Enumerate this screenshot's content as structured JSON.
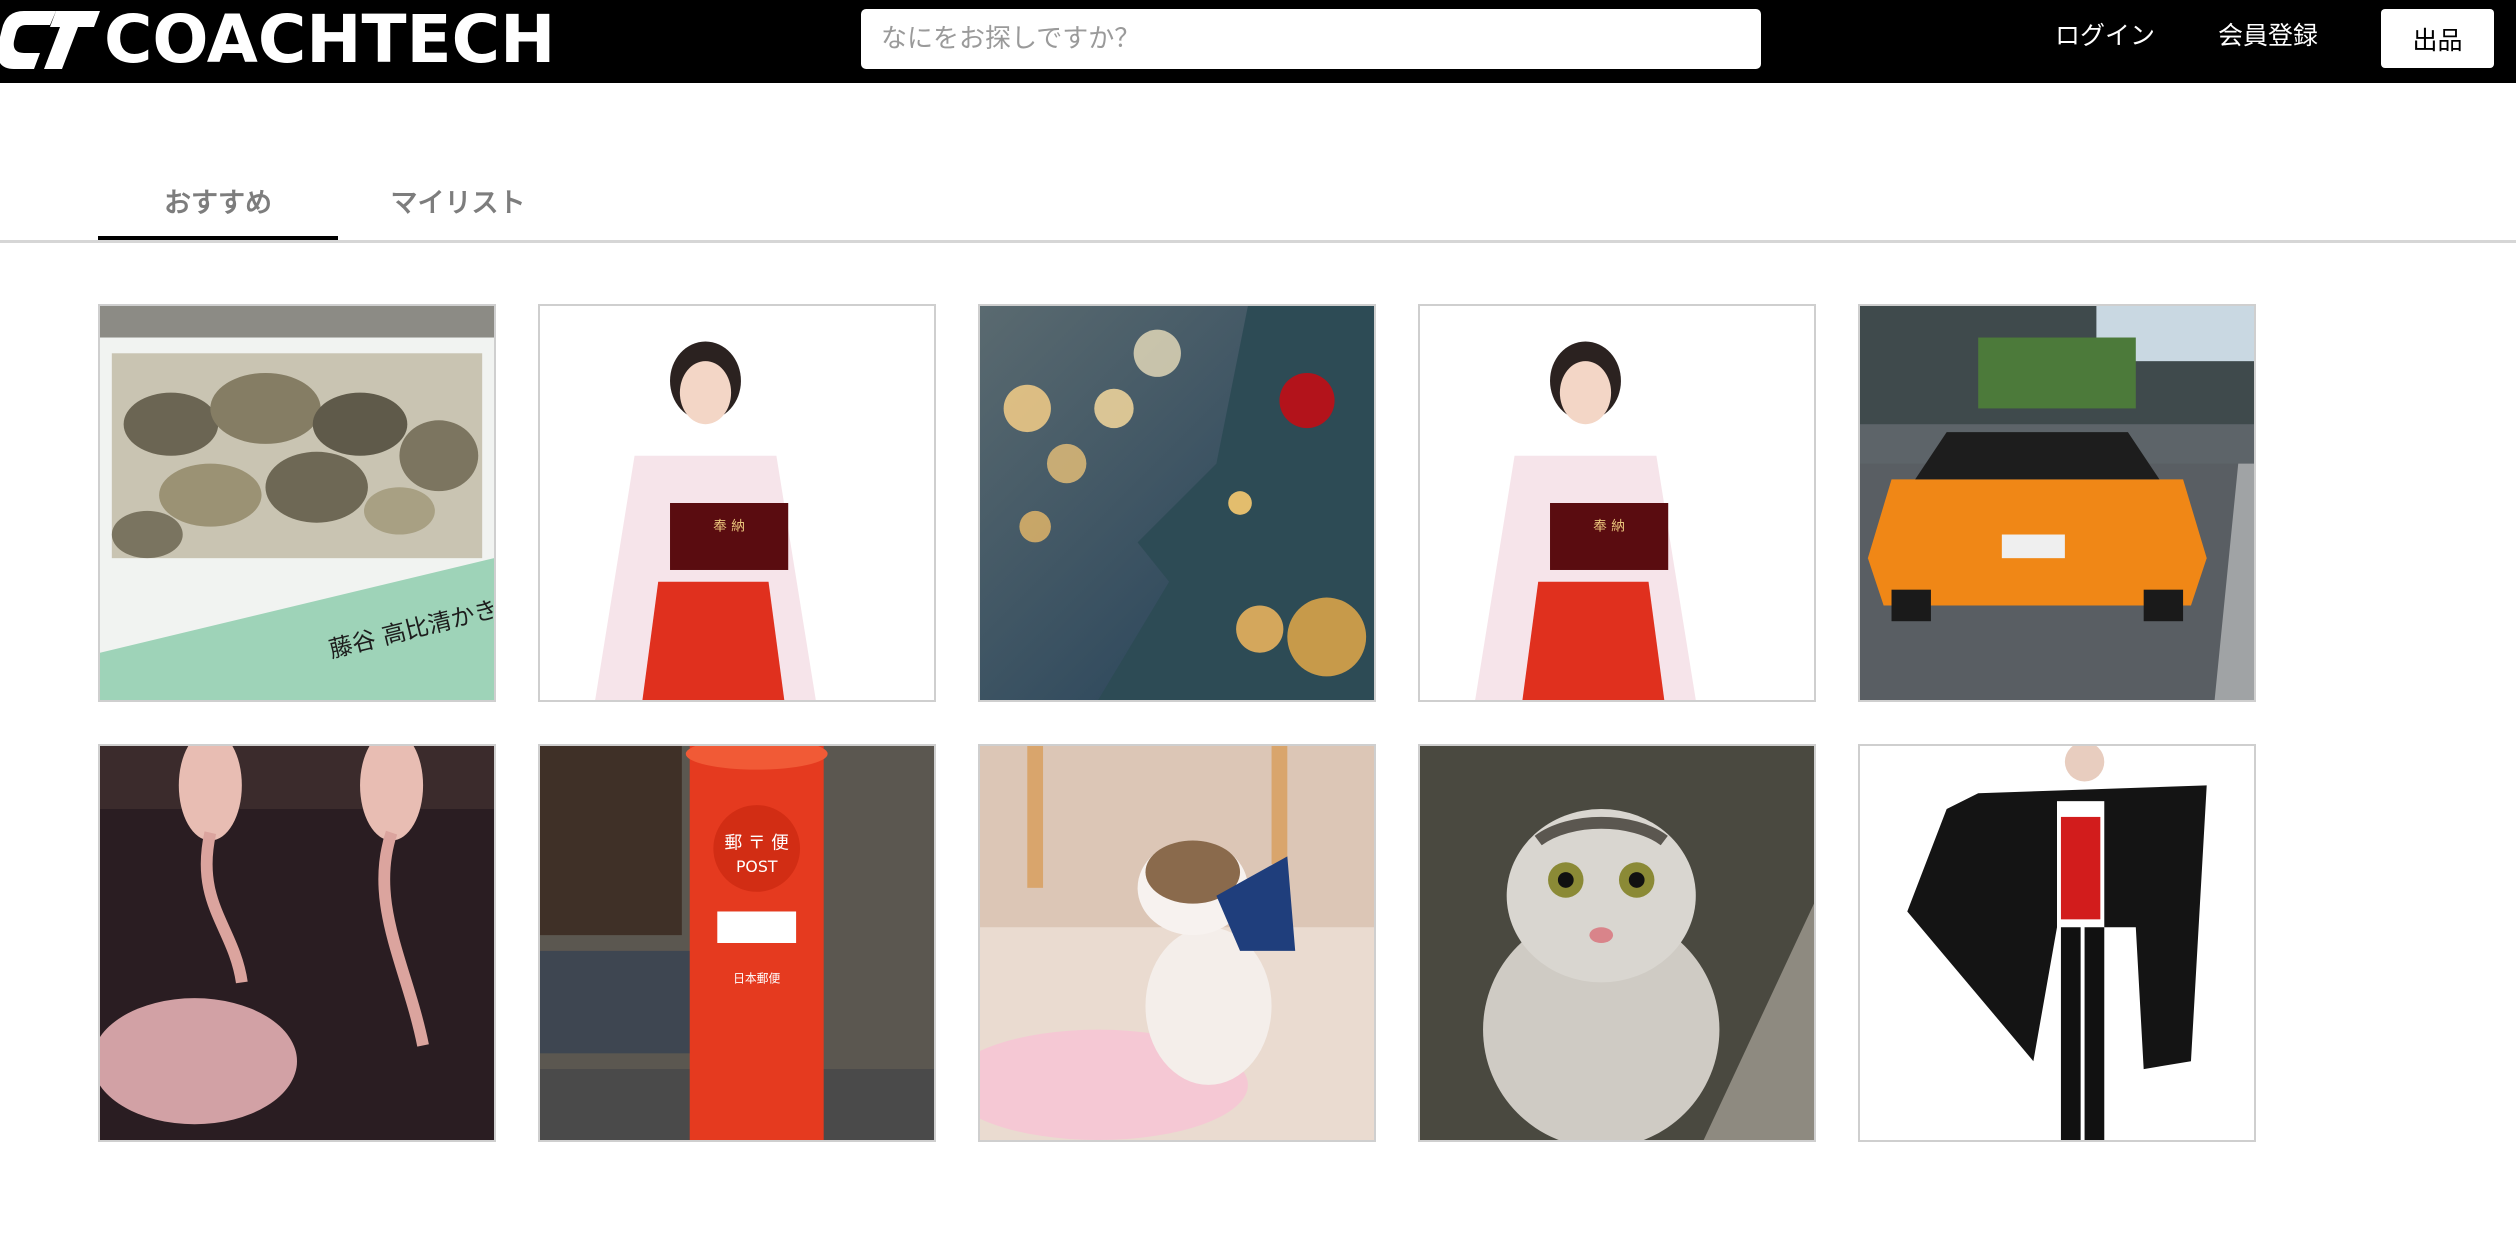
{
  "header": {
    "logo_mark": "CT",
    "logo_text": "COACHTECH",
    "search_placeholder": "なにをお探しですか？",
    "login_label": "ログイン",
    "register_label": "会員登録",
    "sell_label": "出品"
  },
  "tabs": [
    {
      "label": "おすすめ",
      "active": true
    },
    {
      "label": "マイリスト",
      "active": false
    }
  ],
  "colors": {
    "header_bg": "#000000",
    "tab_text": "#7d7d7d",
    "tab_active_indicator": "#000000"
  },
  "items": [
    {
      "image": "oysters-in-styrofoam-box",
      "box_text": "藤谷 高比清かき"
    },
    {
      "image": "shrine-maiden-holding-red-box",
      "box_text": "奉 納"
    },
    {
      "image": "christmas-tree-ornaments"
    },
    {
      "image": "shrine-maiden-holding-red-box",
      "box_text": "奉 納"
    },
    {
      "image": "orange-sports-car-rear"
    },
    {
      "image": "hanging-dried-squid"
    },
    {
      "image": "red-post-box",
      "box_text": [
        "郵 〒 便",
        "POST",
        "日本郵便"
      ]
    },
    {
      "image": "exotic-shorthair-cat"
    },
    {
      "image": "scottish-fold-cat"
    },
    {
      "image": "man-in-vampire-cape"
    }
  ]
}
